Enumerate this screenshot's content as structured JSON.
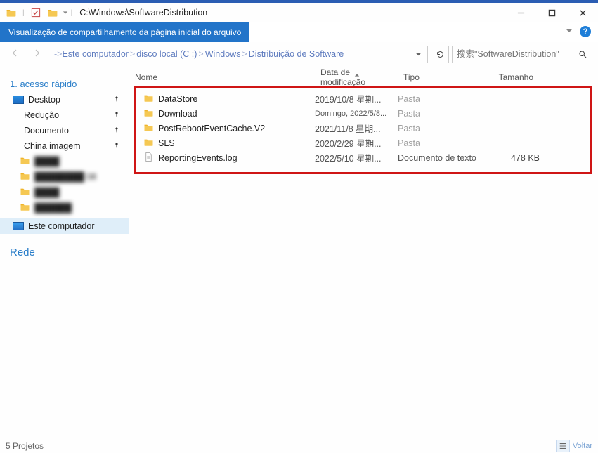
{
  "window": {
    "path": "C:\\Windows\\SoftwareDistribution"
  },
  "ribbon": {
    "tab_label": "Visualização de compartilhamento da página inicial do arquivo",
    "help_label": "?"
  },
  "breadcrumb": {
    "lead": "->",
    "items": [
      "Este computador",
      "disco local (C :)",
      "Windows",
      "Distribuição de Software"
    ]
  },
  "search": {
    "placeholder": "搜索\"SoftwareDistribution\""
  },
  "sidebar": {
    "quick_access": "1. acesso rápido",
    "items": [
      {
        "label": "Desktop",
        "pinned": true,
        "kind": "desktop"
      },
      {
        "label": "Redução",
        "pinned": true,
        "kind": "blue"
      },
      {
        "label": "Documento",
        "pinned": true,
        "kind": "blue"
      },
      {
        "label": "China imagem",
        "pinned": true,
        "kind": "grey"
      }
    ],
    "este": "Este computador",
    "rede": "Rede"
  },
  "columns": {
    "name": "Nome",
    "date": "Data de modificação",
    "type": "Tipo",
    "size": "Tamanho"
  },
  "files": [
    {
      "name": "DataStore",
      "date": "2019/10/8 星期...",
      "type": "Pasta",
      "size": "",
      "kind": "folder"
    },
    {
      "name": "Download",
      "date": "Domingo, 2022/5/8...",
      "type": "Pasta",
      "size": "",
      "kind": "folder"
    },
    {
      "name": "PostRebootEventCache.V2",
      "date": "2021/11/8 星期...",
      "type": "Pasta",
      "size": "",
      "kind": "folder"
    },
    {
      "name": "SLS",
      "date": "2020/2/29 星期...",
      "type": "Pasta",
      "size": "",
      "kind": "folder"
    },
    {
      "name": "ReportingEvents.log",
      "date": "2022/5/10 星期...",
      "type": "Documento de texto",
      "size": "478 KB",
      "kind": "doc"
    }
  ],
  "statusbar": {
    "left": "5 Projetos",
    "right": "Voltar"
  }
}
